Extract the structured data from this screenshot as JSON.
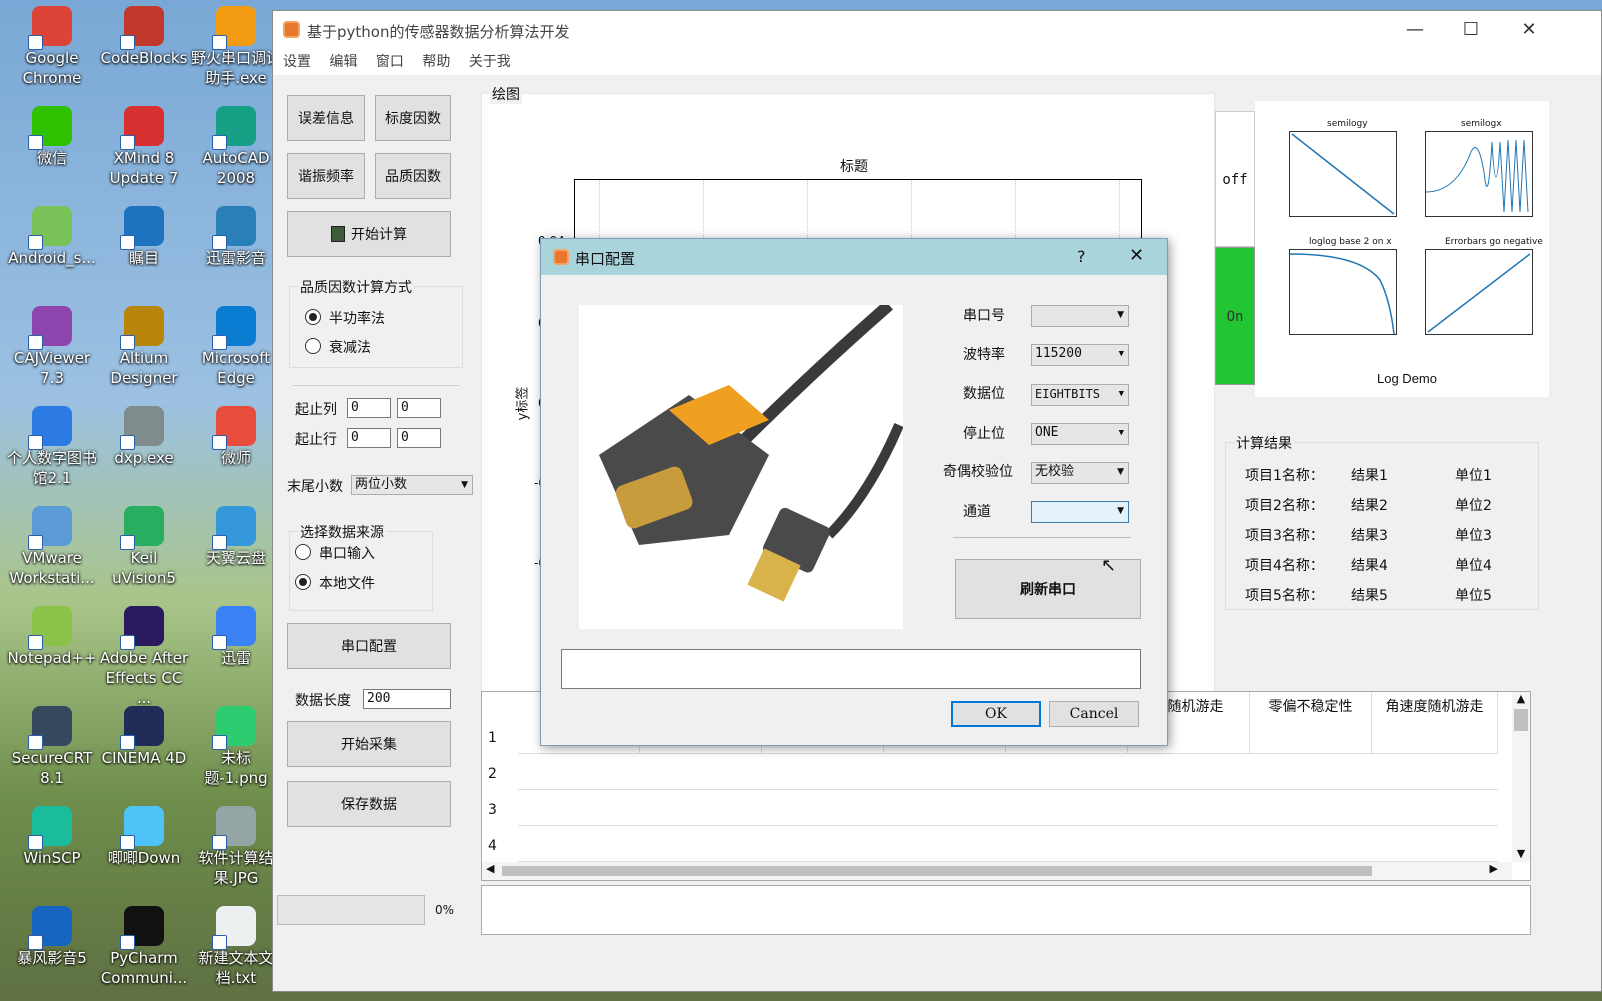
{
  "desktop": {
    "icons": [
      {
        "label": "Google Chrome",
        "color": "#db4437"
      },
      {
        "label": "CodeBlocks",
        "color": "#c0392b"
      },
      {
        "label": "野火串口调试助手.exe",
        "color": "#f39c12"
      },
      {
        "label": "微信",
        "color": "#2dc100"
      },
      {
        "label": "XMind 8 Update 7",
        "color": "#d63031"
      },
      {
        "label": "AutoCAD 2008",
        "color": "#16a085"
      },
      {
        "label": "Android_s...",
        "color": "#78c257"
      },
      {
        "label": "瞩目",
        "color": "#1e73be"
      },
      {
        "label": "迅雷影音",
        "color": "#2980b9"
      },
      {
        "label": "CAJViewer 7.3",
        "color": "#8e44ad"
      },
      {
        "label": "Altium Designer",
        "color": "#b8860b"
      },
      {
        "label": "Microsoft Edge",
        "color": "#0a7cd1"
      },
      {
        "label": "个人数字图书馆2.1",
        "color": "#2c7be5"
      },
      {
        "label": "dxp.exe",
        "color": "#7f8c8d"
      },
      {
        "label": "微师",
        "color": "#e74c3c"
      },
      {
        "label": "VMware Workstati...",
        "color": "#5b9bd5"
      },
      {
        "label": "Keil uVision5",
        "color": "#27ae60"
      },
      {
        "label": "天翼云盘",
        "color": "#3498db"
      },
      {
        "label": "Notepad++",
        "color": "#8bc34a"
      },
      {
        "label": "Adobe After Effects CC ...",
        "color": "#2a1b5e"
      },
      {
        "label": "迅雷",
        "color": "#3b82f6"
      },
      {
        "label": "SecureCRT 8.1",
        "color": "#34495e"
      },
      {
        "label": "CINEMA 4D",
        "color": "#1f2d57"
      },
      {
        "label": "未标题-1.png",
        "color": "#2ecc71"
      },
      {
        "label": "WinSCP",
        "color": "#1abc9c"
      },
      {
        "label": "唧唧Down",
        "color": "#4fc3f7"
      },
      {
        "label": "软件计算结果.JPG",
        "color": "#95a5a6"
      },
      {
        "label": "暴风影音5",
        "color": "#1565c0"
      },
      {
        "label": "PyCharm Communi...",
        "color": "#111111"
      },
      {
        "label": "新建文本文档.txt",
        "color": "#ecf0f1"
      }
    ]
  },
  "window": {
    "title": "基于python的传感器数据分析算法开发",
    "controls": {
      "min": "—",
      "max": "☐",
      "close": "✕"
    }
  },
  "menu": [
    "设置",
    "编辑",
    "窗口",
    "帮助",
    "关于我"
  ],
  "left": {
    "btn_error": "误差信息",
    "btn_scale": "标度因数",
    "btn_freq": "谐振频率",
    "btn_quality": "品质因数",
    "btn_start_calc": "开始计算",
    "quality_group": "品质因数计算方式",
    "quality_opt1": "半功率法",
    "quality_opt2": "衰减法",
    "col_range_label": "起止列",
    "col_start": "0",
    "col_end": "0",
    "row_range_label": "起止行",
    "row_start": "0",
    "row_end": "0",
    "decimal_label": "末尾小数",
    "decimal_value": "两位小数",
    "source_group": "选择数据来源",
    "source_opt1": "串口输入",
    "source_opt2": "本地文件",
    "btn_serial_cfg": "串口配置",
    "data_len_label": "数据长度",
    "data_len_value": "200",
    "btn_collect": "开始采集",
    "btn_save": "保存数据",
    "progress_pct": "0%",
    "progress_value": 0
  },
  "plot": {
    "group_title": "绘图",
    "chart_title": "标题",
    "ylabel": "y标签",
    "yticks": [
      "0.04",
      "0",
      "0",
      "-0",
      "-0"
    ]
  },
  "toggle": {
    "off": "off",
    "on": "On",
    "on_color": "#22c532"
  },
  "thumb": {
    "title": "Log Demo",
    "subtitles": [
      "semilogy",
      "semilogx",
      "loglog base 2 on x",
      "Errorbars go negative"
    ]
  },
  "results": {
    "title": "计算结果",
    "rows": [
      {
        "name": "项目1名称：",
        "value": "结果1",
        "unit": "单位1"
      },
      {
        "name": "项目2名称：",
        "value": "结果2",
        "unit": "单位2"
      },
      {
        "name": "项目3名称：",
        "value": "结果3",
        "unit": "单位3"
      },
      {
        "name": "项目4名称：",
        "value": "结果4",
        "unit": "单位4"
      },
      {
        "name": "项目5名称：",
        "value": "结果5",
        "unit": "单位5"
      }
    ]
  },
  "table": {
    "headers": [
      "度随机游走",
      "零偏不稳定性",
      "角速度随机游走"
    ],
    "row_numbers": [
      "1",
      "2",
      "3",
      "4"
    ]
  },
  "dialog": {
    "title": "串口配置",
    "help": "?",
    "close": "✕",
    "port_label": "串口号",
    "port_value": "",
    "baud_label": "波特率",
    "baud_value": "115200",
    "databits_label": "数据位",
    "databits_value": "EIGHTBITS",
    "stopbits_label": "停止位",
    "stopbits_value": "ONE",
    "parity_label": "奇偶校验位",
    "parity_value": "无校验",
    "channel_label": "通道",
    "channel_value": "",
    "refresh": "刷新串口",
    "ok": "OK",
    "cancel": "Cancel"
  }
}
